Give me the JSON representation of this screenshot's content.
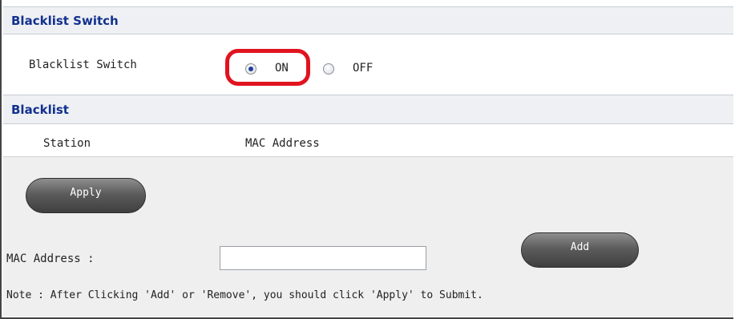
{
  "switch_section": {
    "header": "Blacklist Switch",
    "label": "Blacklist Switch",
    "options": [
      {
        "label": "ON",
        "checked": true
      },
      {
        "label": "OFF",
        "checked": false
      }
    ]
  },
  "blacklist_section": {
    "header": "Blacklist",
    "columns": [
      "Station",
      "MAC Address"
    ]
  },
  "apply_button": "Apply",
  "mac_field": {
    "label": "MAC Address :",
    "value": "",
    "placeholder": ""
  },
  "add_button": "Add",
  "note": "Note : After Clicking 'Add' or 'Remove', you should click 'Apply' to Submit.",
  "colors": {
    "header_text": "#12318f",
    "header_bg": "#eef0f3",
    "highlight_outline": "#e0131f",
    "button_dark": "#4a4a4a"
  }
}
